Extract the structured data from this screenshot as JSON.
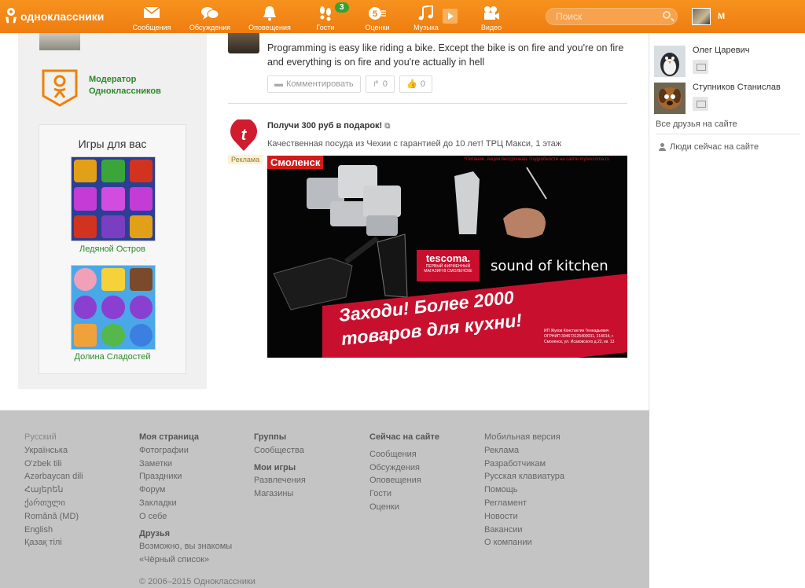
{
  "app": {
    "name": "одноклассники"
  },
  "nav": [
    {
      "label": "Сообщения",
      "icon": "envelope-icon"
    },
    {
      "label": "Обсуждения",
      "icon": "speech-bubbles-icon"
    },
    {
      "label": "Оповещения",
      "icon": "bell-icon"
    },
    {
      "label": "Гости",
      "icon": "footprints-icon",
      "badge": "3"
    },
    {
      "label": "Оценки",
      "icon": "rating-icon"
    },
    {
      "label": "Музыка",
      "icon": "music-note-icon"
    },
    {
      "label": "Видео",
      "icon": "video-camera-icon"
    }
  ],
  "search": {
    "placeholder": "Поиск"
  },
  "user": {
    "initial": "М"
  },
  "left": {
    "moderator_line1": "Модератор",
    "moderator_line2": "Одноклассников",
    "games_title": "Игры для вас",
    "games": [
      {
        "label": "Ледяной Остров"
      },
      {
        "label": "Долина Сладостей"
      }
    ]
  },
  "post": {
    "text": "Programming is easy like riding a bike. Except the bike is on fire and you're on fire and everything is on fire and you're actually in hell",
    "comment_label": "Комментировать",
    "share_count": "0",
    "like_count": "0"
  },
  "ad": {
    "title": "Получи 300 руб в подарок!",
    "description": "Качественная посуда из Чехии с гарантией до 10 лет! ТРЦ Макси, 1 этаж",
    "tag": "Реклама",
    "banner": {
      "city": "Смоленск",
      "top_note": "*Питание. Акция бессрочная. Подробности на сайте mytescoma.ru",
      "brand": "tescoma.",
      "brand_sub": "ПЕРВЫЙ ФИРМЕННЫЙ МАГАЗИН В СМОЛЕНСКЕ",
      "sound": "sound of kitchen",
      "slogan_line1": "Заходи! Более 2000",
      "slogan_line2": "товаров для кухни!",
      "fine_print": "ИП Жуков Константин Геннадьевич ОГРНИП 304673125400031, 214014, г. Смоленск, ул. Исаковского д.22, кв. 13"
    }
  },
  "right": {
    "friends": [
      {
        "name": "Олег Царевич"
      },
      {
        "name": "Ступников Станислав"
      }
    ],
    "all_friends": "Все друзья на сайте",
    "people_now": "Люди сейчас на сайте"
  },
  "footer": {
    "languages": [
      "Русский",
      "Українська",
      "O'zbek tili",
      "Azərbaycan dili",
      "Հայերեն",
      "ქართული",
      "Română (MD)",
      "English",
      "Қазақ тілі"
    ],
    "my_page": {
      "title": "Моя страница",
      "links": [
        "Фотографии",
        "Заметки",
        "Праздники",
        "Форум",
        "Закладки",
        "О себе"
      ]
    },
    "friends": {
      "title": "Друзья",
      "links": [
        "Возможно, вы знакомы",
        "«Чёрный список»"
      ]
    },
    "groups": {
      "title": "Группы",
      "links": [
        "Сообщества"
      ]
    },
    "my_games": {
      "title": "Мои игры",
      "links": [
        "Развлечения",
        "Магазины"
      ]
    },
    "online": {
      "title": "Сейчас на сайте",
      "links": [
        "Сообщения",
        "Обсуждения",
        "Оповещения",
        "Гости",
        "Оценки"
      ]
    },
    "misc": [
      "Мобильная версия",
      "Реклама",
      "Разработчикам",
      "Русская клавиатура",
      "Помощь",
      "Регламент",
      "Новости",
      "Вакансии",
      "О компании"
    ],
    "copyright": "© 2006–2015 Одноклассники"
  },
  "colors": {
    "brand_orange": "#ee8208",
    "link_green": "#2b8a27",
    "ad_red": "#c8102e"
  }
}
